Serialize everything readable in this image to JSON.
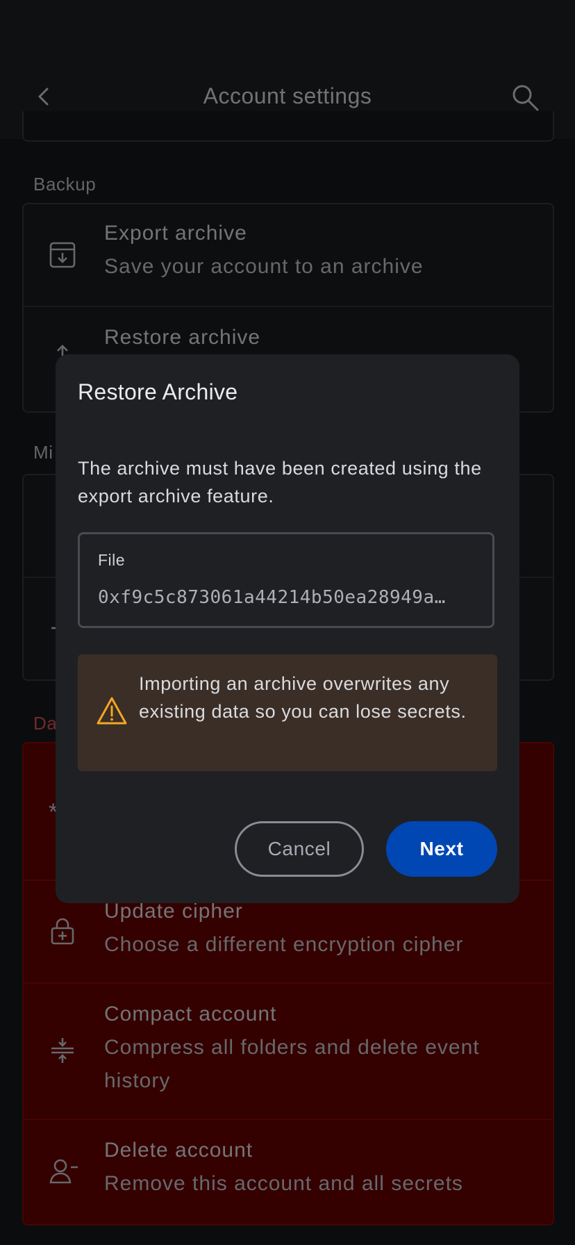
{
  "app_bar": {
    "title": "Account settings",
    "back_icon": "chevron-left-icon",
    "search_icon": "search-icon"
  },
  "sections": {
    "backup": {
      "label": "Backup",
      "items": [
        {
          "title": "Export archive",
          "subtitle": "Save your account to an archive",
          "icon": "download-box-icon"
        },
        {
          "title": "Restore archive",
          "subtitle": "",
          "icon": "upload-icon"
        }
      ]
    },
    "misc": {
      "label": "Mi"
    },
    "danger": {
      "label": "Da",
      "items": [
        {
          "title": "Update cipher",
          "subtitle": "Choose a different encryption cipher",
          "icon": "lock-plus-icon"
        },
        {
          "title": "Compact account",
          "subtitle_line1": "Compress all folders and delete event",
          "subtitle_line2": "history",
          "icon": "compress-icon"
        },
        {
          "title": "Delete account",
          "subtitle": "Remove this account and all secrets",
          "icon": "user-minus-icon"
        }
      ],
      "partial_icon_text": "*"
    }
  },
  "dialog": {
    "title": "Restore Archive",
    "body": "The archive must have been created using the export archive feature.",
    "file_field": {
      "label": "File",
      "value": "0xf9c5c873061a44214b50ea28949a…"
    },
    "warning": {
      "icon": "warning-triangle-icon",
      "text": "Importing an archive overwrites any existing data so you can lose secrets."
    },
    "cancel_label": "Cancel",
    "next_label": "Next"
  },
  "colors": {
    "background": "#17181c",
    "danger_bg": "#690000",
    "primary_button": "#0047b3",
    "warning_icon": "#f5a623",
    "warning_bg": "#3a2e26"
  }
}
